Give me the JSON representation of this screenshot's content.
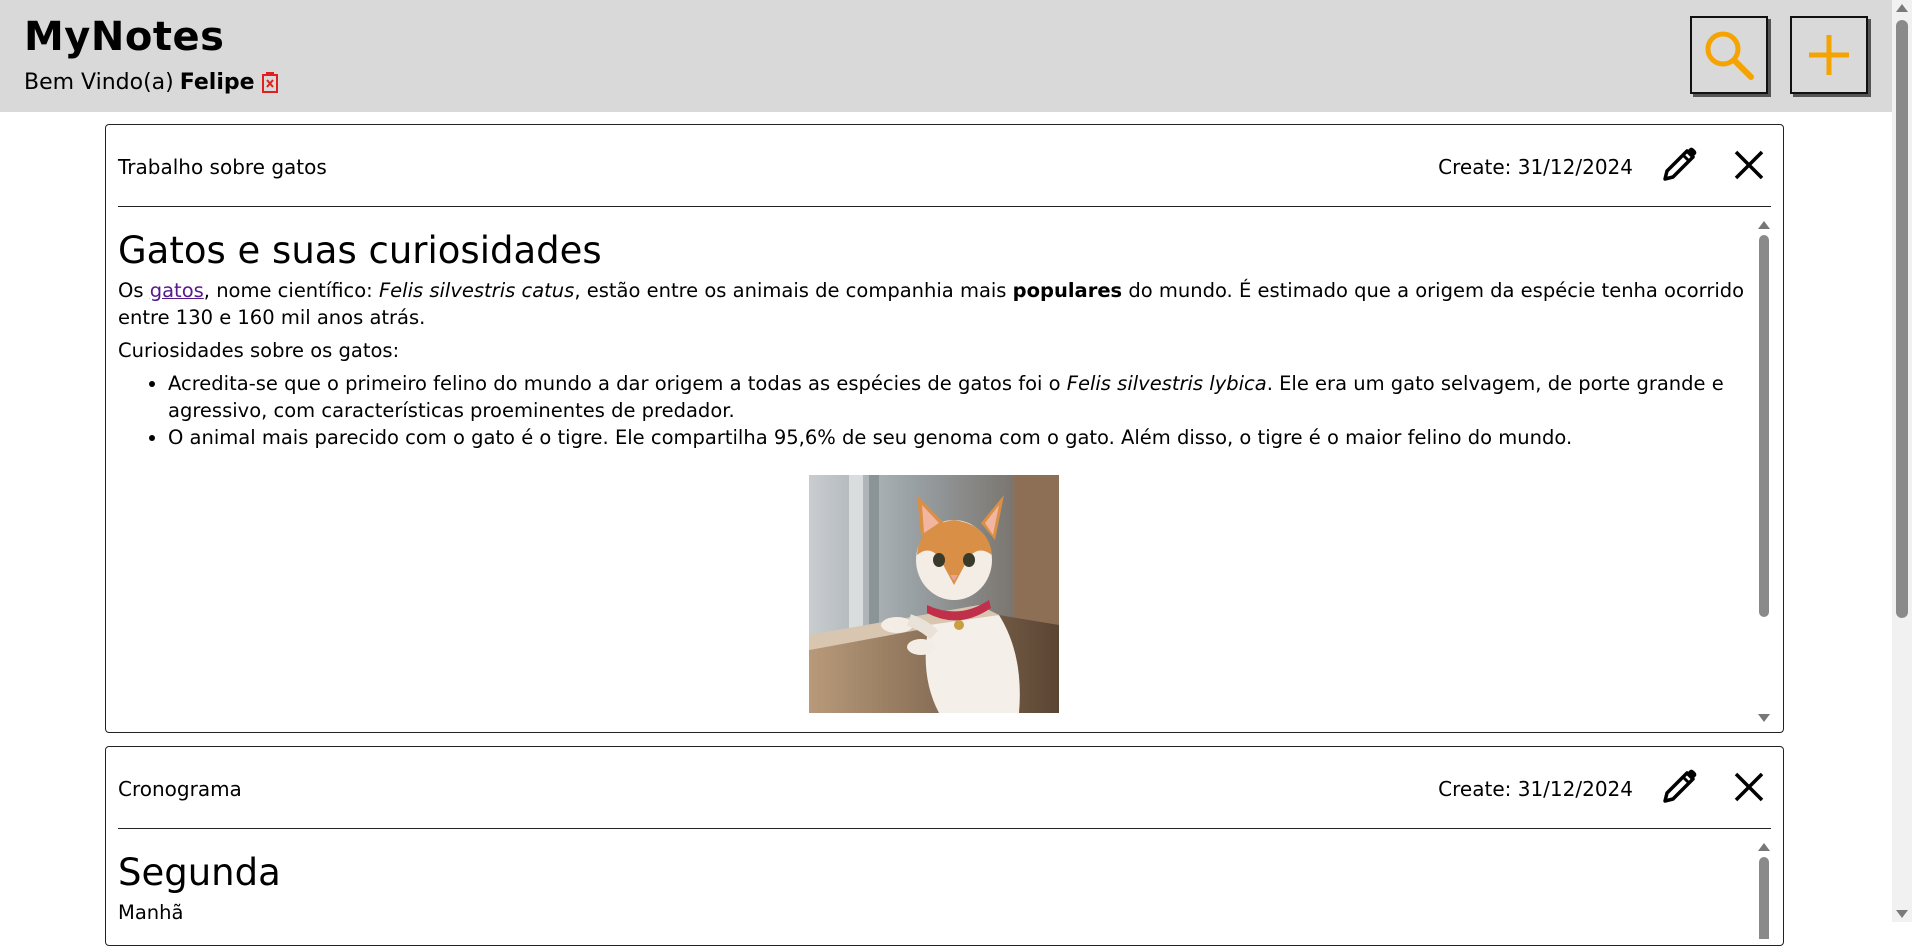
{
  "app": {
    "title": "MyNotes",
    "welcome_prefix": "Bem Vindo(a)",
    "user_name": "Felipe"
  },
  "header_buttons": {
    "search_icon": "search-icon",
    "add_icon": "plus-icon",
    "accent_color": "#f5a300"
  },
  "notes": [
    {
      "title": "Trabalho sobre gatos",
      "date": "Create: 31/12/2024",
      "heading": "Gatos e suas curiosidades",
      "p1_before_link": "Os ",
      "p1_link": "gatos",
      "p1_mid1": ", nome científico: ",
      "p1_italic": "Felis silvestris catus",
      "p1_mid2": ", estão entre os animais de companhia mais ",
      "p1_bold": "populares",
      "p1_after": " do mundo. É estimado que a origem da espécie tenha ocorrido entre 130 e 160 mil anos atrás.",
      "p2": "Curiosidades sobre os gatos:",
      "bullet1_before": "Acredita-se que o primeiro felino do mundo a dar origem a todas as espécies de gatos foi o ",
      "bullet1_italic": "Felis silvestris lybica",
      "bullet1_after": ". Ele era um gato selvagem, de porte grande e agressivo, com características proeminentes de predador.",
      "bullet2": "O animal mais parecido com o gato é o tigre. Ele compartilha 95,6% de seu genoma com o gato. Além disso, o tigre é o maior felino do mundo."
    },
    {
      "title": "Cronograma",
      "date": "Create: 31/12/2024",
      "heading": "Segunda",
      "sub": "Manhã"
    }
  ]
}
